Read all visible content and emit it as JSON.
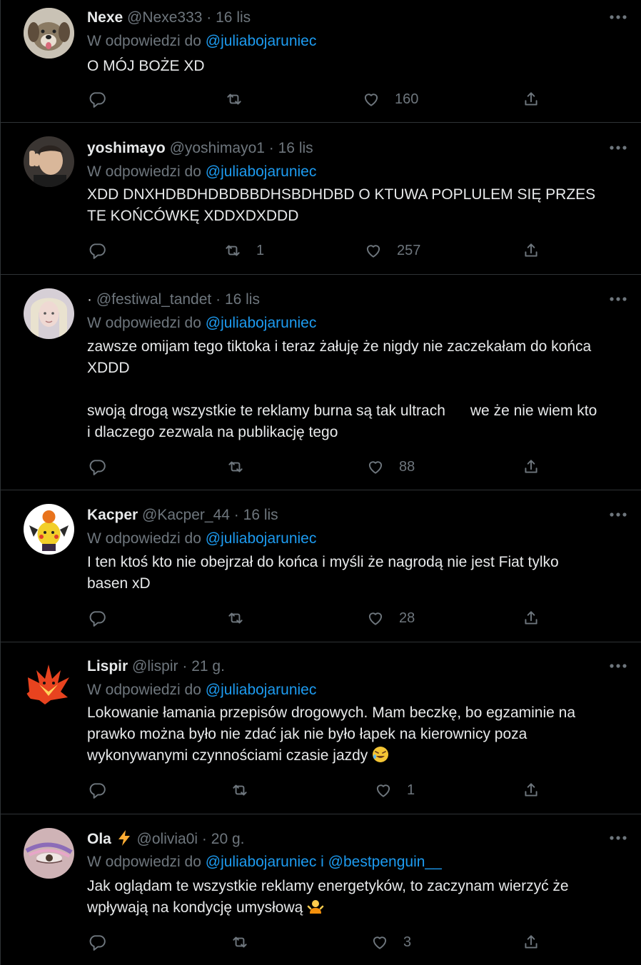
{
  "tweets": [
    {
      "name": "Nexe",
      "handle": "@Nexe333",
      "sep": "·",
      "time": "16 lis",
      "reply_prefix": "W odpowiedzi do",
      "reply_to": "@juliabojaruniec",
      "text": "O MÓJ BOŻE XD",
      "retweets": "",
      "likes": "160",
      "avatar_icon": "dog-avatar"
    },
    {
      "name": "yoshimayo",
      "handle": "@yoshimayo1",
      "sep": "·",
      "time": "16 lis",
      "reply_prefix": "W odpowiedzi do",
      "reply_to": "@juliabojaruniec",
      "text": "XDD DNXHDBDHDBDBBDHSBDHDBD O KTUWA POPLULEM SIĘ PRZES\nTE KOŃCÓWKĘ XDDXDXDDD",
      "retweets": "1",
      "likes": "257",
      "avatar_icon": "person-avatar"
    },
    {
      "name": "·",
      "handle": "@festiwal_tandet",
      "sep": "·",
      "time": "16 lis",
      "reply_prefix": "W odpowiedzi do",
      "reply_to": "@juliabojaruniec",
      "text": "zawsze omijam tego tiktoka i teraz żałuję że nigdy nie zaczekałam do końca\nXDDD\n\nswoją drogą wszystkie te reklamy burna są tak ultrach      we że nie wiem kto\ni dlaczego zezwala na publikację tego",
      "retweets": "",
      "likes": "88",
      "avatar_icon": "blonde-person-avatar"
    },
    {
      "name": "Kacper",
      "handle": "@Kacper_44",
      "sep": "·",
      "time": "16 lis",
      "reply_prefix": "W odpowiedzi do",
      "reply_to": "@juliabojaruniec",
      "text": "I ten ktoś kto nie obejrzał do końca i myśli że nagrodą nie jest Fiat tylko\nbasen xD",
      "retweets": "",
      "likes": "28",
      "avatar_icon": "pikachu-avatar"
    },
    {
      "name": "Lispir",
      "handle": "@lispir",
      "sep": "·",
      "time": "21 g.",
      "reply_prefix": "W odpowiedzi do",
      "reply_to": "@juliabojaruniec",
      "text": "Lokowanie łamania przepisów drogowych. Mam beczkę, bo egzaminie na\nprawko można było nie zdać jak nie było łapek na kierownicy poza\nwykonywanymi czynnościami czasie jazdy",
      "retweets": "",
      "likes": "1",
      "avatar_icon": "fox-avatar"
    },
    {
      "name": "Ola",
      "handle": "@olivia0i",
      "sep": "·",
      "time": "20 g.",
      "reply_prefix": "W odpowiedzi do",
      "reply_to": "@juliabojaruniec i @bestpenguin__",
      "text": "Jak oglądam te wszystkie reklamy energetyków, to zaczynam wierzyć że\nwpływają na kondycję umysłową",
      "retweets": "",
      "likes": "3",
      "avatar_icon": "eye-makeup-avatar"
    }
  ],
  "colors": {
    "background": "#000000",
    "text": "#e7e9ea",
    "muted": "#6e767d",
    "link": "#1d9bf0",
    "divider": "#2f3336"
  },
  "icons": {
    "reply": "reply-icon",
    "retweet": "retweet-icon",
    "like": "heart-icon",
    "share": "share-icon",
    "more": "more-icon",
    "lightning": "lightning-icon"
  }
}
